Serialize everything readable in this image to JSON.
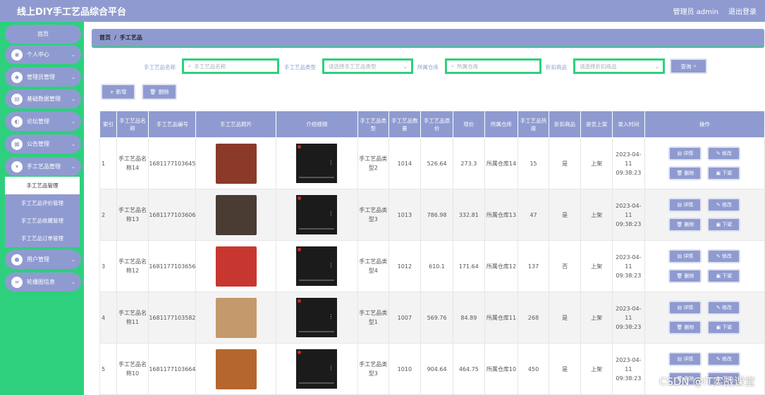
{
  "app": {
    "title": "线上DIY手工艺品综合平台",
    "admin": "管理员 admin",
    "logout": "退出登录"
  },
  "sidebar": {
    "home": "首页",
    "items": [
      {
        "label": "个人中心",
        "icon": "user-icon"
      },
      {
        "label": "管理员管理",
        "icon": "admin-icon"
      },
      {
        "label": "基础数据管理",
        "icon": "database-icon"
      },
      {
        "label": "论坛管理",
        "icon": "forum-icon"
      },
      {
        "label": "公告管理",
        "icon": "notice-icon"
      },
      {
        "label": "手工艺品管理",
        "icon": "craft-icon"
      },
      {
        "label": "用户管理",
        "icon": "location-icon"
      },
      {
        "label": "轮播图信息",
        "icon": "list-icon"
      }
    ],
    "subitems": [
      "手工艺品管理",
      "手工艺品评价管理",
      "手工艺品收藏管理",
      "手工艺品订单管理"
    ]
  },
  "breadcrumb": {
    "home": "首页",
    "sep": "/",
    "current": "手工艺品"
  },
  "search": {
    "name_label": "手工艺品名称",
    "name_placeholder": "手工艺品名称",
    "type_label": "手工艺品类型",
    "type_placeholder": "请选择手工艺品类型",
    "warehouse_label": "所属仓库",
    "warehouse_placeholder": "所属仓库",
    "discount_label": "折扣商品",
    "discount_placeholder": "请选择折扣商品",
    "query_button": "查询"
  },
  "toolbar": {
    "add": "+ 新增",
    "delete": "删除"
  },
  "table": {
    "headers": [
      "索引",
      "手工艺品名称",
      "手工艺品编号",
      "手工艺品照片",
      "介绍视频",
      "手工艺品类型",
      "手工艺品数量",
      "手工艺品原价",
      "现价",
      "所属仓库",
      "手工艺品热度",
      "折扣商品",
      "是否上架",
      "录入时间",
      "操作"
    ],
    "rows": [
      {
        "index": "1",
        "name": "手工艺品名称14",
        "code": "1681177103645",
        "type": "手工艺品类型2",
        "qty": "1014",
        "orig": "526.64",
        "price": "273.3",
        "wh": "所属仓库14",
        "heat": "15",
        "discount": "是",
        "listed": "上架",
        "time": "2023-04-11 09:38:23",
        "photo_color": "#8b3a2a"
      },
      {
        "index": "2",
        "name": "手工艺品名称13",
        "code": "1681177103606",
        "type": "手工艺品类型3",
        "qty": "1013",
        "orig": "786.98",
        "price": "332.81",
        "wh": "所属仓库13",
        "heat": "47",
        "discount": "是",
        "listed": "上架",
        "time": "2023-04-11 09:38:23",
        "photo_color": "#4a3b33"
      },
      {
        "index": "3",
        "name": "手工艺品名称12",
        "code": "1681177103656",
        "type": "手工艺品类型4",
        "qty": "1012",
        "orig": "610.1",
        "price": "171.64",
        "wh": "所属仓库12",
        "heat": "137",
        "discount": "否",
        "listed": "上架",
        "time": "2023-04-11 09:38:23",
        "photo_color": "#c8372f"
      },
      {
        "index": "4",
        "name": "手工艺品名称11",
        "code": "1681177103582",
        "type": "手工艺品类型1",
        "qty": "1007",
        "orig": "569.76",
        "price": "84.89",
        "wh": "所属仓库11",
        "heat": "268",
        "discount": "是",
        "listed": "上架",
        "time": "2023-04-11 09:38:23",
        "photo_color": "#c49a6c"
      },
      {
        "index": "5",
        "name": "手工艺品名称10",
        "code": "1681177103664",
        "type": "手工艺品类型3",
        "qty": "1010",
        "orig": "904.64",
        "price": "464.75",
        "wh": "所属仓库10",
        "heat": "450",
        "discount": "是",
        "listed": "上架",
        "time": "2023-04-11 09:38:23",
        "photo_color": "#b5662e"
      }
    ],
    "ops": {
      "detail": "详情",
      "edit": "修改",
      "delete": "删除",
      "offshelf": "下架"
    }
  },
  "watermark": "CSDN @IT实战课堂",
  "colors": {
    "primary": "#8f9bd0",
    "sidebar": "#2ed07d"
  }
}
